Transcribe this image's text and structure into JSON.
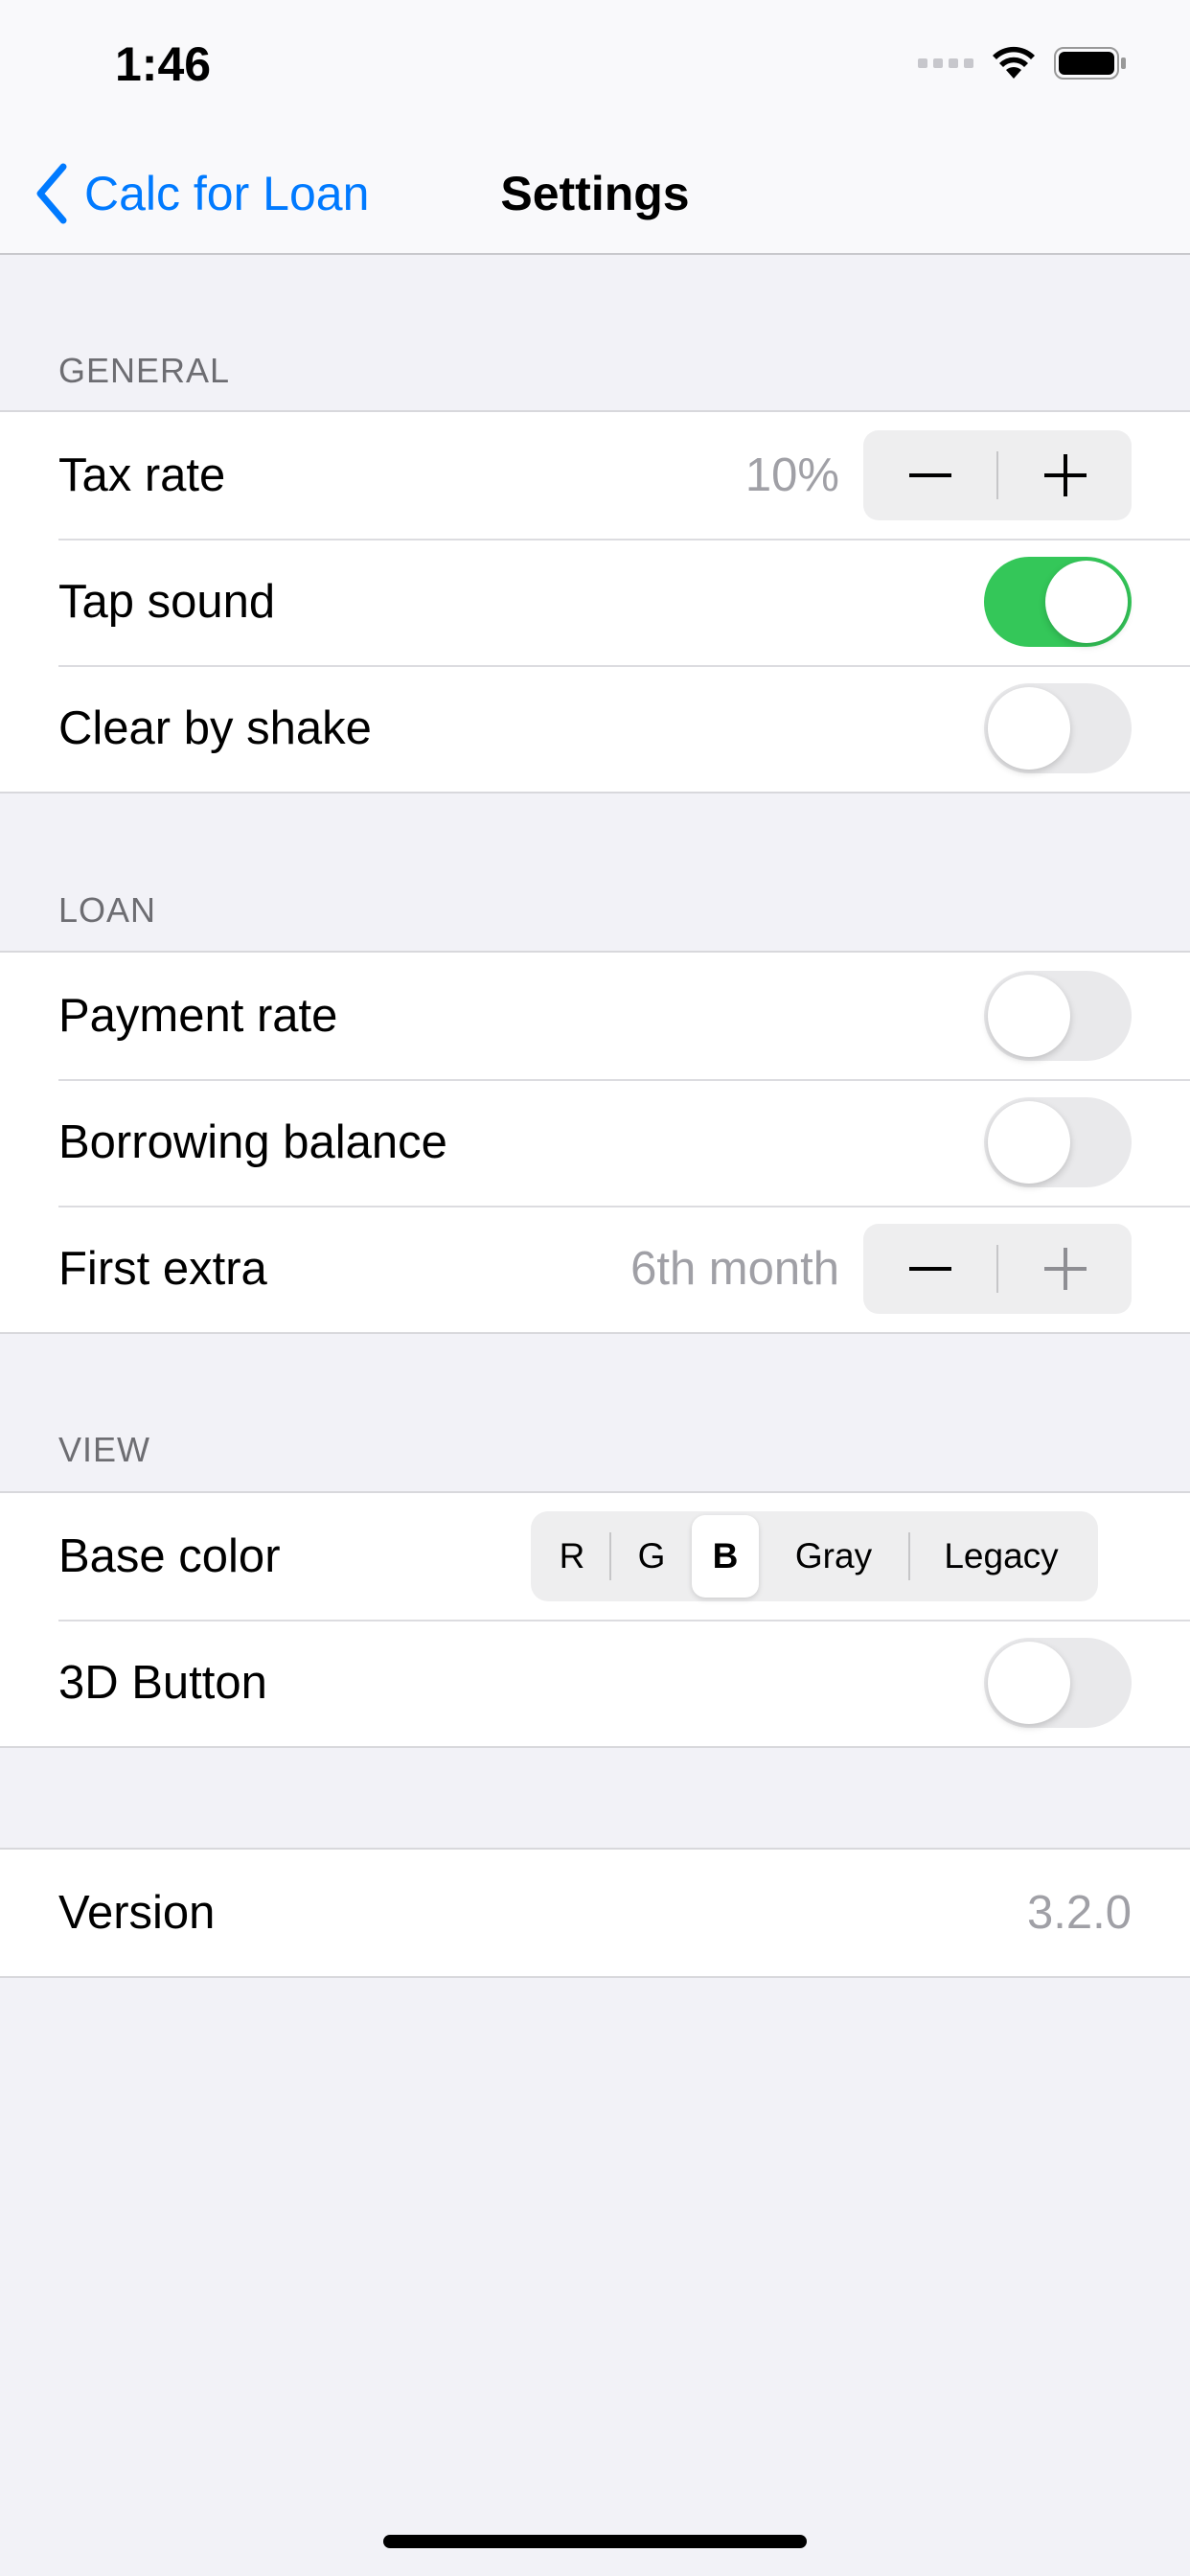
{
  "status_bar": {
    "time": "1:46"
  },
  "nav": {
    "back_label": "Calc for Loan",
    "title": "Settings"
  },
  "sections": {
    "general": {
      "header": "GENERAL",
      "tax_rate": {
        "label": "Tax rate",
        "value": "10%"
      },
      "tap_sound": {
        "label": "Tap sound",
        "on": true
      },
      "clear_by_shake": {
        "label": "Clear by shake",
        "on": false
      }
    },
    "loan": {
      "header": "LOAN",
      "payment_rate": {
        "label": "Payment rate",
        "on": false
      },
      "borrowing_balance": {
        "label": "Borrowing balance",
        "on": false
      },
      "first_extra": {
        "label": "First extra",
        "value": "6th month"
      }
    },
    "view": {
      "header": "VIEW",
      "base_color": {
        "label": "Base color",
        "options": [
          "R",
          "G",
          "B",
          "Gray",
          "Legacy"
        ],
        "selected": "B"
      },
      "button_3d": {
        "label": "3D Button",
        "on": false
      }
    },
    "about": {
      "version": {
        "label": "Version",
        "value": "3.2.0"
      }
    }
  },
  "colors": {
    "accent": "#007aff",
    "toggle_on": "#34c759"
  },
  "icons": [
    "chevron-left-icon",
    "wifi-icon",
    "battery-icon",
    "cellular-signal-icon",
    "minus-icon",
    "plus-icon"
  ]
}
